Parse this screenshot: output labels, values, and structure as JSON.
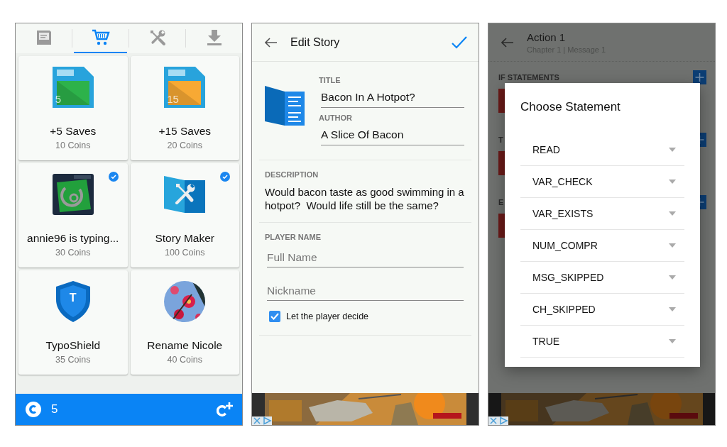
{
  "shop": {
    "tabs": [
      {
        "kind": "save",
        "selected": false
      },
      {
        "kind": "cart",
        "selected": true
      },
      {
        "kind": "tools",
        "selected": false
      },
      {
        "kind": "download",
        "selected": false
      }
    ],
    "items": [
      {
        "kind": "saves",
        "count": "5",
        "color": "#2db24a",
        "name": "+5 Saves",
        "price": "10 Coins",
        "owned": false
      },
      {
        "kind": "saves",
        "count": "15",
        "color": "#f7a934",
        "name": "+15 Saves",
        "price": "20 Coins",
        "owned": false
      },
      {
        "kind": "picture",
        "name": "annie96 is typing...",
        "price": "30 Coins",
        "owned": true
      },
      {
        "kind": "story-maker",
        "name": "Story Maker",
        "price": "100 Coins",
        "owned": true
      },
      {
        "kind": "shield",
        "letter": "T",
        "name": "TypoShield",
        "price": "35 Coins",
        "owned": false
      },
      {
        "name": "Rename Nicole",
        "price": "40 Coins",
        "owned": false
      }
    ],
    "coins": "5"
  },
  "edit_story": {
    "title": "Edit Story",
    "fields": [
      {
        "label": "TITLE",
        "value": "Bacon In A Hotpot?"
      },
      {
        "label": "AUTHOR",
        "value": "A Slice Of Bacon"
      }
    ],
    "description": {
      "label": "DESCRIPTION",
      "text": "Would bacon taste as good swimming in a hotpot?  Would life still be the same?"
    },
    "player_name": {
      "label": "PLAYER NAME",
      "inputs": [
        {
          "placeholder": "Full Name"
        },
        {
          "placeholder": "Nickname"
        }
      ],
      "checkbox": {
        "label": "Let the player decide",
        "checked": true
      }
    }
  },
  "action": {
    "title": "Action 1",
    "subtitle": "Chapter 1 | Message 1",
    "sections": [
      {
        "label": "IF STATEMENTS"
      },
      {
        "label": "T"
      },
      {
        "label": "E"
      }
    ],
    "dialog": {
      "title": "Choose Statement",
      "options": [
        "READ",
        "VAR_CHECK",
        "VAR_EXISTS",
        "NUM_COMPR",
        "MSG_SKIPPED",
        "CH_SKIPPED",
        "TRUE"
      ]
    }
  }
}
